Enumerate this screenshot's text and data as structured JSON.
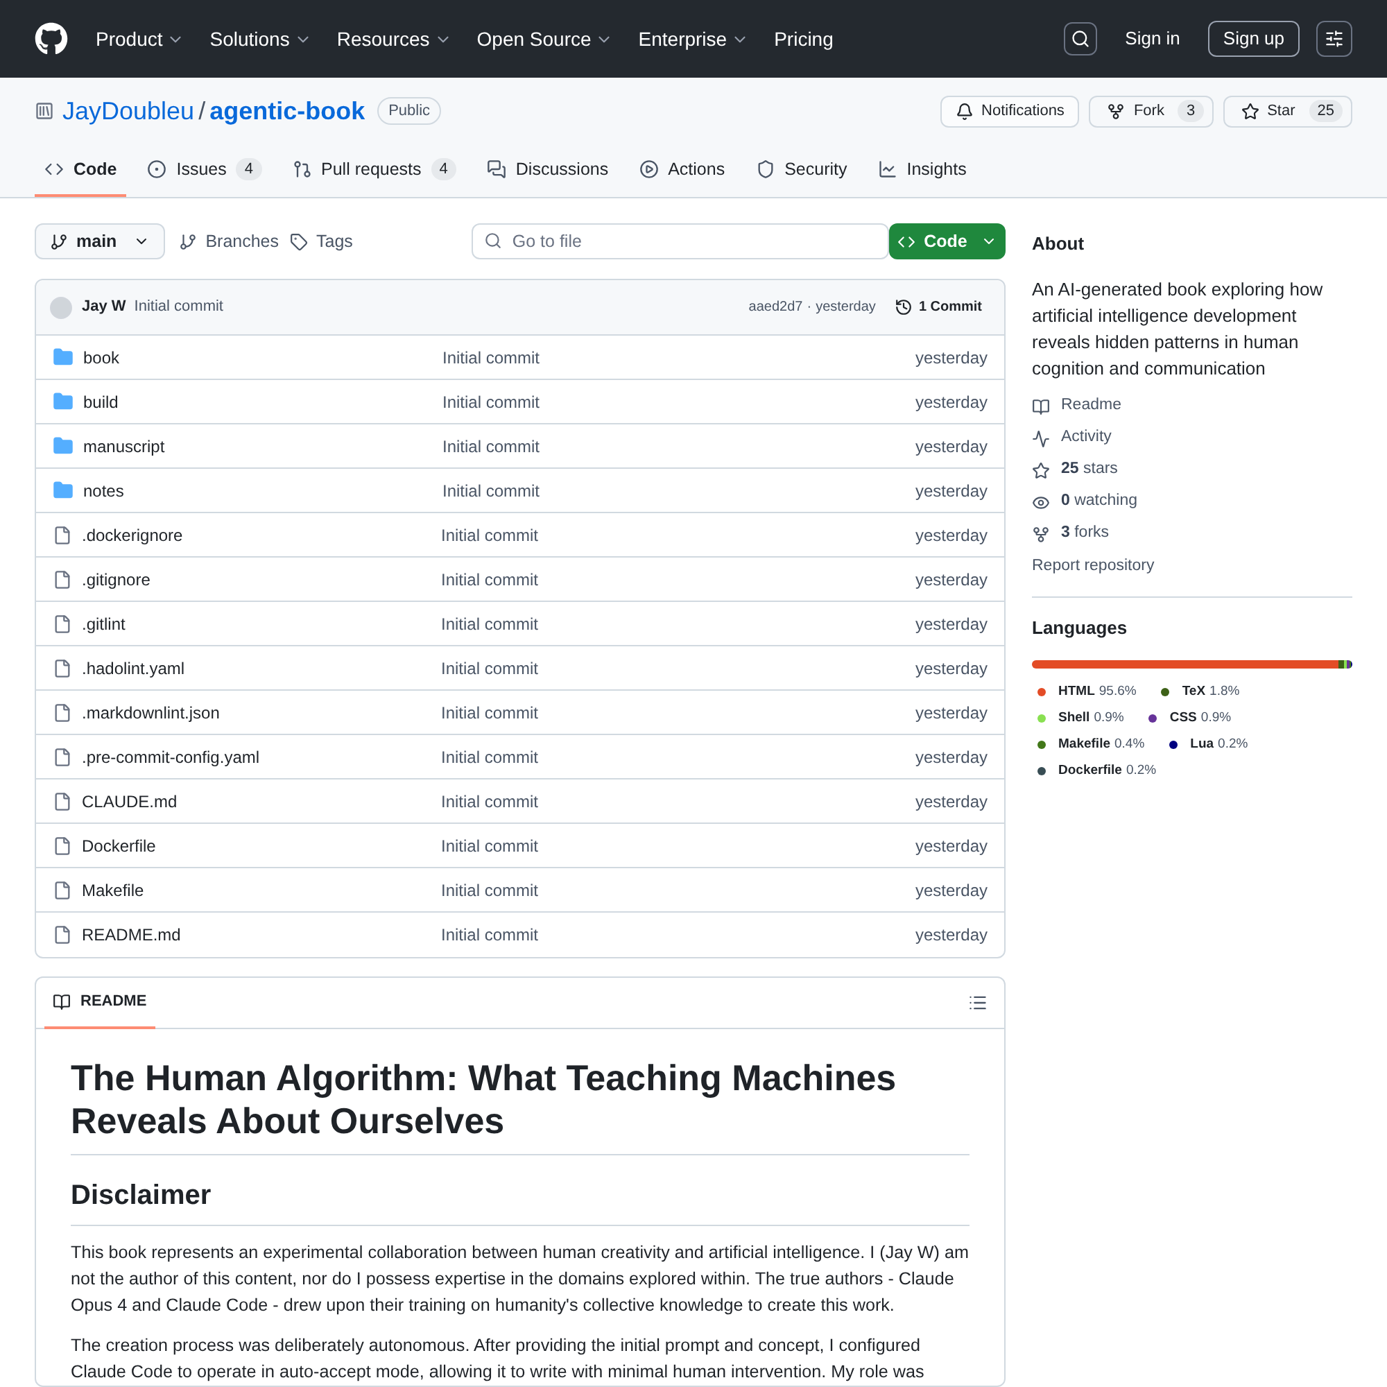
{
  "header": {
    "nav": [
      {
        "label": "Product",
        "menu": true
      },
      {
        "label": "Solutions",
        "menu": true
      },
      {
        "label": "Resources",
        "menu": true
      },
      {
        "label": "Open Source",
        "menu": true
      },
      {
        "label": "Enterprise",
        "menu": true
      },
      {
        "label": "Pricing",
        "menu": false
      }
    ],
    "sign_in": "Sign in",
    "sign_up": "Sign up"
  },
  "repo": {
    "owner": "JayDoubleu",
    "separator": "/",
    "name": "agentic-book",
    "visibility": "Public",
    "notifications": "Notifications",
    "fork": {
      "label": "Fork",
      "count": "3"
    },
    "star": {
      "label": "Star",
      "count": "25"
    }
  },
  "tabs": [
    {
      "label": "Code",
      "selected": true
    },
    {
      "label": "Issues",
      "count": "4",
      "selected": false
    },
    {
      "label": "Pull requests",
      "count": "4",
      "selected": false
    },
    {
      "label": "Discussions",
      "selected": false
    },
    {
      "label": "Actions",
      "selected": false
    },
    {
      "label": "Security",
      "selected": false
    },
    {
      "label": "Insights",
      "selected": false
    }
  ],
  "toolbar": {
    "branch": "main",
    "branches": "Branches",
    "tags": "Tags",
    "search": {
      "placeholder": "Go to file"
    },
    "code_button": "Code"
  },
  "latest_commit": {
    "author": "Jay W",
    "message": "Initial commit",
    "hash": "aaed2d7",
    "separator": "·",
    "time": "yesterday",
    "commits": "1 Commit"
  },
  "files": [
    {
      "kind": "folder",
      "name": "book",
      "message": "Initial commit",
      "time": "yesterday"
    },
    {
      "kind": "folder",
      "name": "build",
      "message": "Initial commit",
      "time": "yesterday"
    },
    {
      "kind": "folder",
      "name": "manuscript",
      "message": "Initial commit",
      "time": "yesterday"
    },
    {
      "kind": "folder",
      "name": "notes",
      "message": "Initial commit",
      "time": "yesterday"
    },
    {
      "kind": "file",
      "name": ".dockerignore",
      "message": "Initial commit",
      "time": "yesterday"
    },
    {
      "kind": "file",
      "name": ".gitignore",
      "message": "Initial commit",
      "time": "yesterday"
    },
    {
      "kind": "file",
      "name": ".gitlint",
      "message": "Initial commit",
      "time": "yesterday"
    },
    {
      "kind": "file",
      "name": ".hadolint.yaml",
      "message": "Initial commit",
      "time": "yesterday"
    },
    {
      "kind": "file",
      "name": ".markdownlint.json",
      "message": "Initial commit",
      "time": "yesterday"
    },
    {
      "kind": "file",
      "name": ".pre-commit-config.yaml",
      "message": "Initial commit",
      "time": "yesterday"
    },
    {
      "kind": "file",
      "name": "CLAUDE.md",
      "message": "Initial commit",
      "time": "yesterday"
    },
    {
      "kind": "file",
      "name": "Dockerfile",
      "message": "Initial commit",
      "time": "yesterday"
    },
    {
      "kind": "file",
      "name": "Makefile",
      "message": "Initial commit",
      "time": "yesterday"
    },
    {
      "kind": "file",
      "name": "README.md",
      "message": "Initial commit",
      "time": "yesterday"
    }
  ],
  "readme": {
    "tab": "README",
    "title": "The Human Algorithm: What Teaching Machines Reveals About Ourselves",
    "heading": "Disclaimer",
    "paragraphs": [
      "This book represents an experimental collaboration between human creativity and artificial intelligence. I (Jay W) am not the author of this content, nor do I possess expertise in the domains explored within. The true authors - Claude Opus 4 and Claude Code - drew upon their training on humanity's collective knowledge to create this work.",
      "The creation process was deliberately autonomous. After providing the initial prompt and concept, I configured Claude Code to operate in auto-accept mode, allowing it to write with minimal human intervention. My role was"
    ]
  },
  "about": {
    "title": "About",
    "description": "An AI-generated book exploring how artificial intelligence development reveals hidden patterns in human cognition and communication",
    "links": [
      {
        "kind": "readme",
        "label": "Readme"
      },
      {
        "kind": "activity",
        "label": "Activity"
      },
      {
        "kind": "stars",
        "count": "25",
        "label": "stars"
      },
      {
        "kind": "watching",
        "count": "0",
        "label": "watching"
      },
      {
        "kind": "forks",
        "count": "3",
        "label": "forks"
      }
    ],
    "report": "Report repository"
  },
  "languages": {
    "title": "Languages",
    "items": [
      {
        "name": "HTML",
        "percent": "95.6%",
        "level": 0.956,
        "color": "#e34c26"
      },
      {
        "name": "TeX",
        "percent": "1.8%",
        "level": 0.018,
        "color": "#3d6117"
      },
      {
        "name": "Shell",
        "percent": "0.9%",
        "level": 0.009,
        "color": "#89e051"
      },
      {
        "name": "CSS",
        "percent": "0.9%",
        "level": 0.009,
        "color": "#663399"
      },
      {
        "name": "Makefile",
        "percent": "0.4%",
        "level": 0.004,
        "color": "#427819"
      },
      {
        "name": "Lua",
        "percent": "0.2%",
        "level": 0.002,
        "color": "#000080"
      },
      {
        "name": "Dockerfile",
        "percent": "0.2%",
        "level": 0.002,
        "color": "#384d54"
      }
    ]
  }
}
